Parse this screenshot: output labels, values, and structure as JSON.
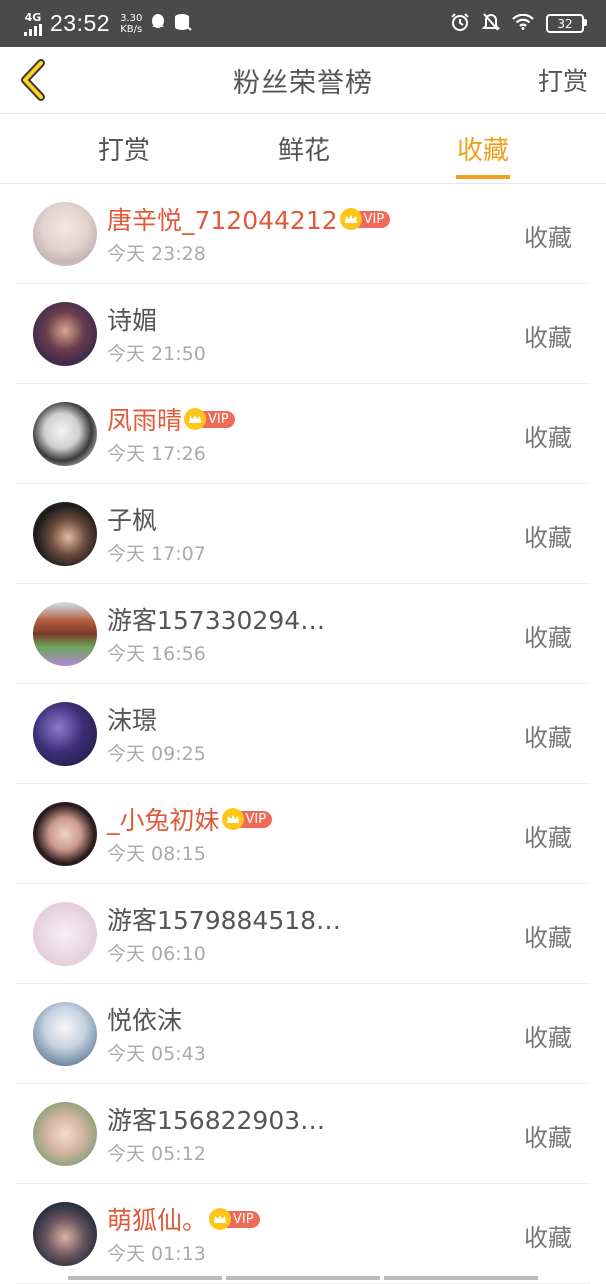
{
  "status": {
    "network": "4G",
    "time": "23:52",
    "speed_value": "3.30",
    "speed_unit": "KB/s",
    "battery": "32"
  },
  "header": {
    "title": "粉丝荣誉榜",
    "right_action": "打赏"
  },
  "tabs": [
    {
      "label": "打赏"
    },
    {
      "label": "鲜花"
    },
    {
      "label": "收藏"
    }
  ],
  "active_tab": 2,
  "vip_label": "VIP",
  "rows": [
    {
      "name": "唐辛悦_712044212",
      "time": "今天 23:28",
      "action": "收藏"
    },
    {
      "name": "诗媚",
      "time": "今天 21:50",
      "action": "收藏"
    },
    {
      "name": "凤雨晴",
      "time": "今天 17:26",
      "action": "收藏"
    },
    {
      "name": "子枫",
      "time": "今天 17:07",
      "action": "收藏"
    },
    {
      "name": "游客157330294…",
      "time": "今天 16:56",
      "action": "收藏"
    },
    {
      "name": "沫璟",
      "time": "今天 09:25",
      "action": "收藏"
    },
    {
      "name": "_小兔初妹",
      "time": "今天 08:15",
      "action": "收藏"
    },
    {
      "name": "游客1579884518…",
      "time": "今天 06:10",
      "action": "收藏"
    },
    {
      "name": "悦依沫",
      "time": "今天 05:43",
      "action": "收藏"
    },
    {
      "name": "游客156822903…",
      "time": "今天 05:12",
      "action": "收藏"
    },
    {
      "name": "萌狐仙。",
      "time": "今天 01:13",
      "action": "收藏"
    }
  ],
  "colors": {
    "accent": "#f0a020",
    "vip_name": "#e05a3a",
    "vip_tag": "#f06a5a",
    "crown": "#ffc61a"
  }
}
